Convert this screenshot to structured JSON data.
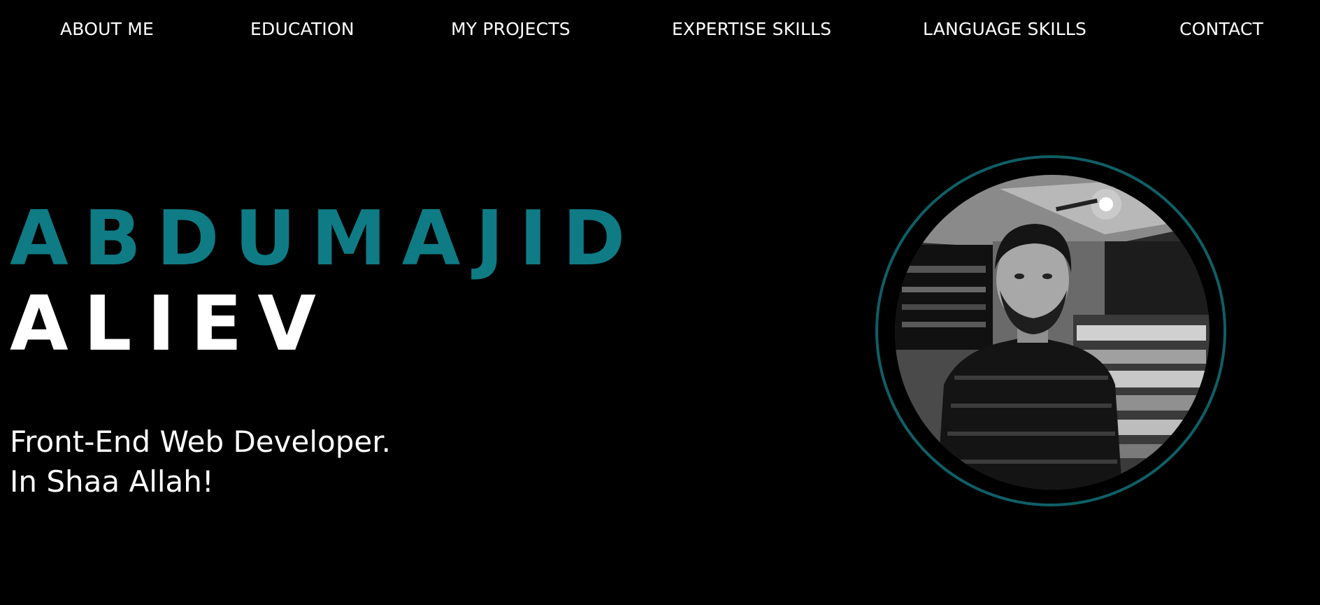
{
  "nav": {
    "items": [
      {
        "label": "ABOUT ME"
      },
      {
        "label": "EDUCATION"
      },
      {
        "label": "MY PROJECTS"
      },
      {
        "label": "EXPERTISE SKILLS"
      },
      {
        "label": "LANGUAGE SKILLS"
      },
      {
        "label": "CONTACT"
      }
    ]
  },
  "hero": {
    "first_name": "ABDUMAJID",
    "last_name": "ALIEV",
    "tagline_line1": "Front-End Web Developer.",
    "tagline_line2": "In Shaa Allah!"
  },
  "colors": {
    "background": "#000000",
    "accent": "#0f7b85",
    "ring": "#0f5f66",
    "text": "#ffffff"
  },
  "avatar": {
    "icon": "profile-photo"
  }
}
